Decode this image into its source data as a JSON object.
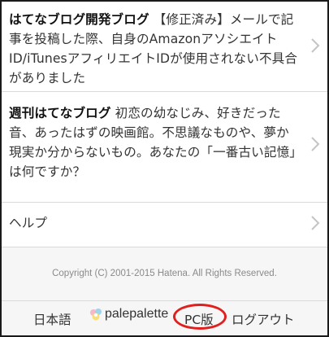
{
  "entries": [
    {
      "source": "はてなブログ開発ブログ",
      "text": "【修正済み】メールで記事を投稿した際、自身のAmazonアソシエイトID/iTunesアフィリエイトIDが使用されない不具合がありました"
    },
    {
      "source": "週刊はてなブログ",
      "text": "初恋の幼なじみ、好きだった音、あったはずの映画館。不思議なものや、夢か現実か分からないもの。あなたの「一番古い記憶」は何ですか？"
    }
  ],
  "help": {
    "label": "ヘルプ"
  },
  "copyright": "Copyright (C) 2001-2015 Hatena. All Rights Reserved.",
  "footer": {
    "language": "日本語",
    "username": "palepalette",
    "pc_version": "PC版",
    "logout": "ログアウト"
  },
  "colors": {
    "highlight_circle": "#e0201f",
    "footer_bg": "#f6f6f6",
    "divider": "#dadada"
  },
  "icons": {
    "chevron": "chevron-right-icon",
    "avatar": "user-avatar-icon"
  }
}
